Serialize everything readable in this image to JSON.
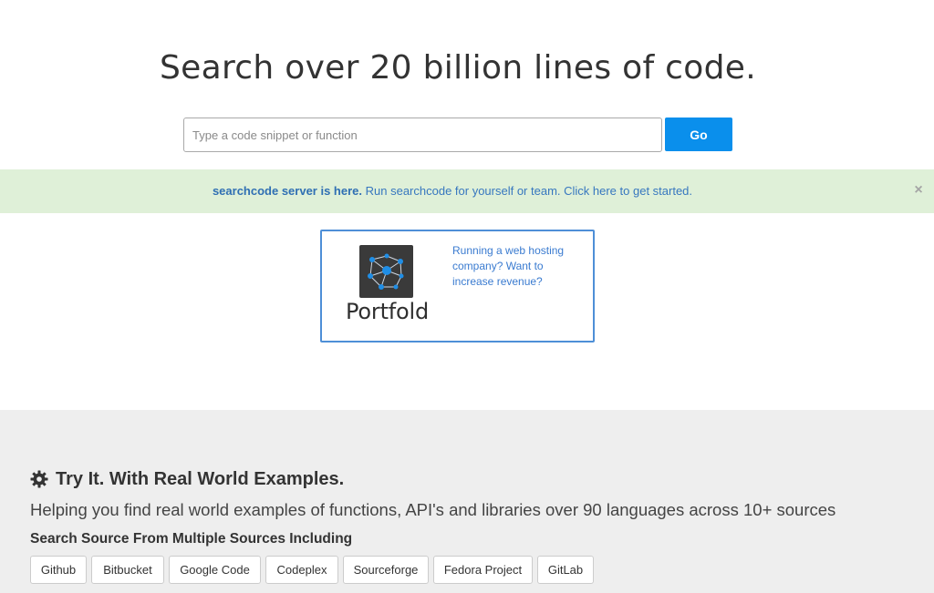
{
  "hero": {
    "title": "Search over 20 billion lines of code.",
    "search_placeholder": "Type a code snippet or function",
    "search_value": "",
    "go_label": "Go"
  },
  "alert": {
    "strong_text": "searchcode server is here.",
    "text": " Run searchcode for yourself or team. Click here to get started.",
    "close_label": "×"
  },
  "ad": {
    "logo_text": "Portfold",
    "copy": "Running a web hosting company? Want to increase revenue?"
  },
  "examples": {
    "heading": "Try It. With Real World Examples.",
    "heading_icon": "gear-icon",
    "subheading": "Helping you find real world examples of functions, API's and libraries over 90 languages across 10+ sources",
    "sources_title": "Search Source From Multiple Sources Including",
    "sources": [
      "Github",
      "Bitbucket",
      "Google Code",
      "Codeplex",
      "Sourceforge",
      "Fedora Project",
      "GitLab"
    ]
  },
  "colors": {
    "accent": "#0a8fec",
    "alert_bg": "#dff0d8",
    "link": "#3777bf",
    "section_bg": "#eeeeee"
  }
}
